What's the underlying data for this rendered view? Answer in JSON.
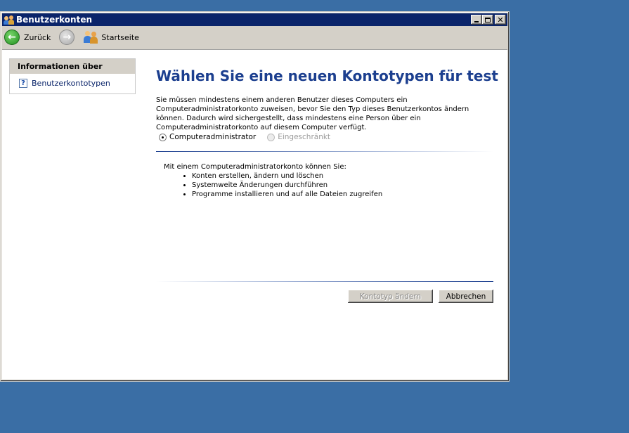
{
  "window": {
    "title": "Benutzerkonten"
  },
  "toolbar": {
    "back_label": "Zurück",
    "home_label": "Startseite"
  },
  "sidebar": {
    "header": "Informationen über",
    "link": "Benutzerkontotypen"
  },
  "main": {
    "heading": "Wählen Sie eine neuen Kontotypen für test",
    "description": "Sie müssen mindestens einem anderen Benutzer dieses Computers ein Computeradministratorkonto zuweisen, bevor Sie den Typ dieses Benutzerkontos ändern können. Dadurch wird sichergestellt, dass mindestens eine Person über ein Computeradministratorkonto auf diesem Computer verfügt.",
    "radio_admin": "Computeradministrator",
    "radio_limited": "Eingeschränkt",
    "info_intro": "Mit einem Computeradministratorkonto können Sie:",
    "info_items": [
      "Konten erstellen, ändern und löschen",
      "Systemweite Änderungen durchführen",
      "Programme installieren und auf alle Dateien zugreifen"
    ],
    "btn_change": "Kontotyp ändern",
    "btn_cancel": "Abbrechen"
  },
  "colors": {
    "desktop": "#3a6ea5",
    "titlebar": "#0a246a",
    "heading": "#1c3f8f"
  }
}
